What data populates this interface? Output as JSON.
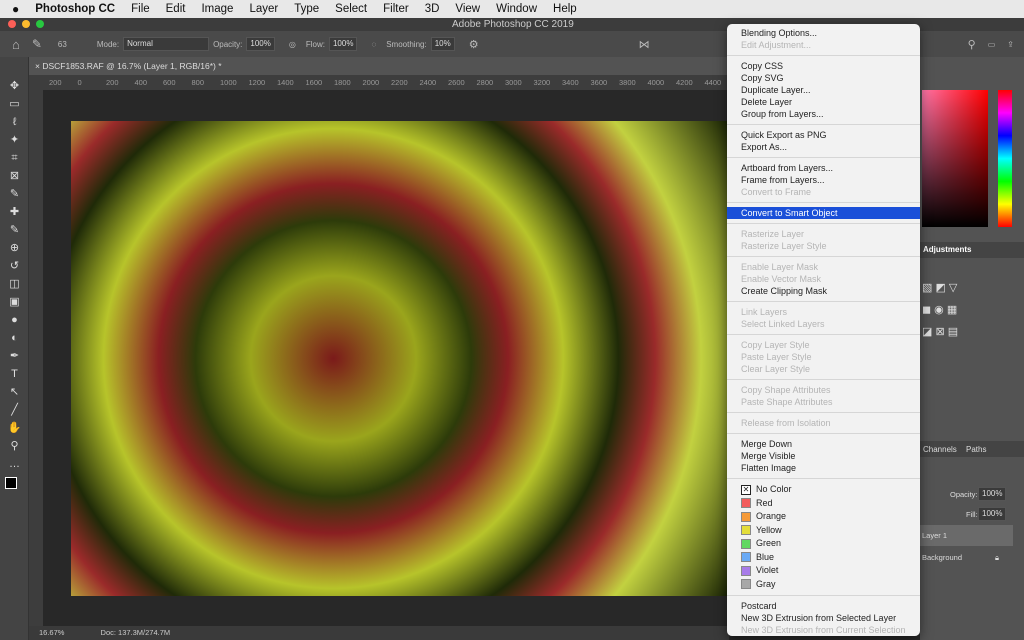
{
  "menubar": {
    "app": "Photoshop CC",
    "items": [
      "File",
      "Edit",
      "Image",
      "Layer",
      "Type",
      "Select",
      "Filter",
      "3D",
      "View",
      "Window",
      "Help"
    ]
  },
  "window_title": "Adobe Photoshop CC 2019",
  "options": {
    "brush_size": "63",
    "mode_label": "Mode:",
    "mode": "Normal",
    "opacity_label": "Opacity:",
    "opacity": "100%",
    "flow_label": "Flow:",
    "flow": "100%",
    "smoothing_label": "Smoothing:",
    "smoothing": "10%"
  },
  "document_tab": "DSCF1853.RAF @ 16.7% (Layer 1, RGB/16*) *",
  "ruler_ticks": [
    "200",
    "0",
    "200",
    "400",
    "600",
    "800",
    "1000",
    "1200",
    "1400",
    "1600",
    "1800",
    "2000",
    "2200",
    "2400",
    "2600",
    "2800",
    "3000",
    "3200",
    "3400",
    "3600",
    "3800",
    "4000",
    "4200",
    "4400"
  ],
  "status": {
    "zoom": "16.67%",
    "doc": "Doc: 137.3M/274.7M"
  },
  "panels": {
    "adjustments_tab": "Adjustments",
    "paths_tab": "Paths",
    "layers_tab": "Channels",
    "opacity_label": "Opacity:",
    "opacity": "100%",
    "fill_label": "Fill:",
    "fill": "100%",
    "layer1": "Layer 1",
    "background": "Background"
  },
  "context_menu": {
    "groups": [
      [
        {
          "label": "Blending Options...",
          "enabled": true
        },
        {
          "label": "Edit Adjustment...",
          "enabled": false
        }
      ],
      [
        {
          "label": "Copy CSS",
          "enabled": true
        },
        {
          "label": "Copy SVG",
          "enabled": true
        },
        {
          "label": "Duplicate Layer...",
          "enabled": true
        },
        {
          "label": "Delete Layer",
          "enabled": true
        },
        {
          "label": "Group from Layers...",
          "enabled": true
        }
      ],
      [
        {
          "label": "Quick Export as PNG",
          "enabled": true
        },
        {
          "label": "Export As...",
          "enabled": true
        }
      ],
      [
        {
          "label": "Artboard from Layers...",
          "enabled": true
        },
        {
          "label": "Frame from Layers...",
          "enabled": true
        },
        {
          "label": "Convert to Frame",
          "enabled": false
        }
      ],
      [
        {
          "label": "Convert to Smart Object",
          "enabled": true,
          "highlighted": true
        }
      ],
      [
        {
          "label": "Rasterize Layer",
          "enabled": false
        },
        {
          "label": "Rasterize Layer Style",
          "enabled": false
        }
      ],
      [
        {
          "label": "Enable Layer Mask",
          "enabled": false
        },
        {
          "label": "Enable Vector Mask",
          "enabled": false
        },
        {
          "label": "Create Clipping Mask",
          "enabled": true
        }
      ],
      [
        {
          "label": "Link Layers",
          "enabled": false
        },
        {
          "label": "Select Linked Layers",
          "enabled": false
        }
      ],
      [
        {
          "label": "Copy Layer Style",
          "enabled": false
        },
        {
          "label": "Paste Layer Style",
          "enabled": false
        },
        {
          "label": "Clear Layer Style",
          "enabled": false
        }
      ],
      [
        {
          "label": "Copy Shape Attributes",
          "enabled": false
        },
        {
          "label": "Paste Shape Attributes",
          "enabled": false
        }
      ],
      [
        {
          "label": "Release from Isolation",
          "enabled": false
        }
      ],
      [
        {
          "label": "Merge Down",
          "enabled": true
        },
        {
          "label": "Merge Visible",
          "enabled": true
        },
        {
          "label": "Flatten Image",
          "enabled": true
        }
      ]
    ],
    "colors": [
      {
        "label": "No Color",
        "color": "none"
      },
      {
        "label": "Red",
        "color": "#f25c5c"
      },
      {
        "label": "Orange",
        "color": "#f59a38"
      },
      {
        "label": "Yellow",
        "color": "#e3dd3a"
      },
      {
        "label": "Green",
        "color": "#62d862"
      },
      {
        "label": "Blue",
        "color": "#6aaaf5"
      },
      {
        "label": "Violet",
        "color": "#a77be8"
      },
      {
        "label": "Gray",
        "color": "#a8a8a8"
      }
    ],
    "tail": [
      {
        "label": "Postcard",
        "enabled": true
      },
      {
        "label": "New 3D Extrusion from Selected Layer",
        "enabled": true
      },
      {
        "label": "New 3D Extrusion from Current Selection",
        "enabled": false
      }
    ]
  }
}
